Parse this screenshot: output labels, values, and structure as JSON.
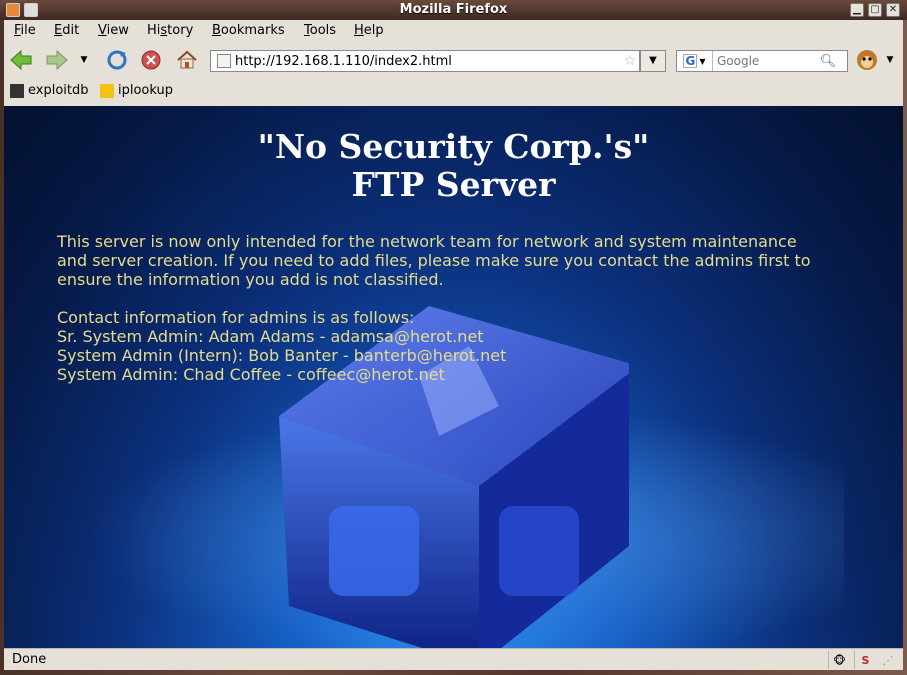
{
  "window": {
    "title": "Mozilla Firefox"
  },
  "menu": [
    "File",
    "Edit",
    "View",
    "History",
    "Bookmarks",
    "Tools",
    "Help"
  ],
  "menu_accel": [
    "F",
    "E",
    "V",
    "s",
    "B",
    "T",
    "H"
  ],
  "nav": {
    "url": "http://192.168.1.110/index2.html",
    "search_placeholder": "Google"
  },
  "bookmarks": [
    {
      "label": "exploitdb",
      "icon": "exploitdb-favicon"
    },
    {
      "label": "iplookup",
      "icon": "iplookup-favicon"
    }
  ],
  "page": {
    "heading_line1": "\"No Security Corp.'s\"",
    "heading_line2": "FTP Server",
    "intro_line1": "This server is now only intended for the network team for network and system maintenance",
    "intro_line2": "and server creation. If you need to add files, please make sure you contact the admins first to",
    "intro_line3": "ensure the information you add is not classified.",
    "contact_header": "Contact information for admins is as follows:",
    "contacts": [
      "Sr. System Admin: Adam Adams - adamsa@herot.net",
      "System Admin (Intern): Bob Banter - banterb@herot.net",
      "System Admin: Chad Coffee - coffeec@herot.net"
    ]
  },
  "status": {
    "text": "Done"
  },
  "colors": {
    "heading": "#ffffff",
    "body_text": "#e6dc8e",
    "chrome": "#e5e1d8"
  }
}
